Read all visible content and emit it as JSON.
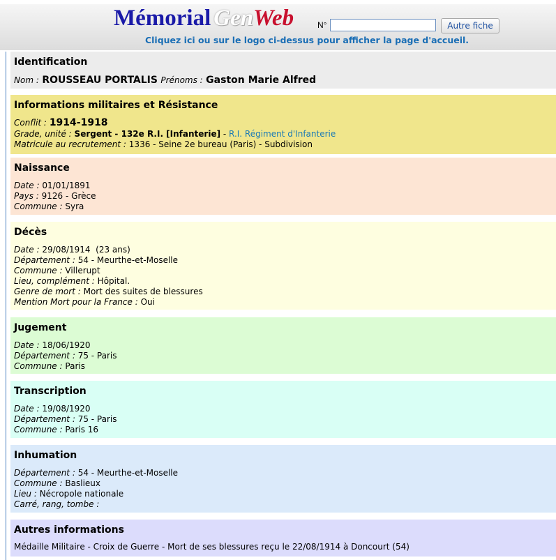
{
  "header": {
    "logo_part1": "Mémorial",
    "logo_part2": "Gen",
    "logo_part3": "Web",
    "search_label": "N°",
    "search_value": "",
    "search_button": "Autre fiche",
    "home_link": "Cliquez ici ou sur le logo ci-dessus pour afficher la page d'accueil."
  },
  "identification": {
    "title": "Identification",
    "nom_label": "Nom :",
    "nom_value": "ROUSSEAU PORTALIS",
    "prenoms_label": "Prénoms :",
    "prenoms_value": "Gaston Marie Alfred"
  },
  "militaire": {
    "title": "Informations militaires et Résistance",
    "conflit_label": "Conflit :",
    "conflit_value": "1914-1918",
    "grade_label": "Grade, unité :",
    "grade_value": "Sergent - 132e R.I. [Infanterie]",
    "grade_sep": " - ",
    "grade_link": "R.I. Régiment d'Infanterie",
    "matricule_label": "Matricule au recrutement :",
    "matricule_value": "1336 - Seine 2e bureau (Paris) - Subdivision"
  },
  "naissance": {
    "title": "Naissance",
    "date_label": "Date :",
    "date_value": "01/01/1891",
    "pays_label": "Pays :",
    "pays_value": "9126 - Grèce",
    "commune_label": "Commune :",
    "commune_value": "Syra"
  },
  "deces": {
    "title": "Décès",
    "date_label": "Date :",
    "date_value": "29/08/1914  (23 ans)",
    "dept_label": "Département :",
    "dept_value": "54 - Meurthe-et-Moselle",
    "commune_label": "Commune :",
    "commune_value": "Villerupt",
    "lieu_label": "Lieu, complément :",
    "lieu_value": "Hôpital.",
    "genre_label": "Genre de mort :",
    "genre_value": "Mort des suites de blessures",
    "mention_label": "Mention Mort pour la France :",
    "mention_value": "Oui"
  },
  "jugement": {
    "title": "Jugement",
    "date_label": "Date :",
    "date_value": "18/06/1920",
    "dept_label": "Département :",
    "dept_value": "75 - Paris",
    "commune_label": "Commune :",
    "commune_value": "Paris"
  },
  "transcription": {
    "title": "Transcription",
    "date_label": "Date :",
    "date_value": "19/08/1920",
    "dept_label": "Département :",
    "dept_value": "75 - Paris",
    "commune_label": "Commune :",
    "commune_value": "Paris 16"
  },
  "inhumation": {
    "title": "Inhumation",
    "dept_label": "Département :",
    "dept_value": "54 - Meurthe-et-Moselle",
    "commune_label": "Commune :",
    "commune_value": "Baslieux",
    "lieu_label": "Lieu :",
    "lieu_value": "Nécropole nationale",
    "carre_label": "Carré, rang, tombe :",
    "carre_value": ""
  },
  "autres": {
    "title": "Autres informations",
    "text": "Médaille Militaire - Croix de Guerre - Mort de ses blessures reçu le 22/08/1914 à Doncourt (54)"
  }
}
